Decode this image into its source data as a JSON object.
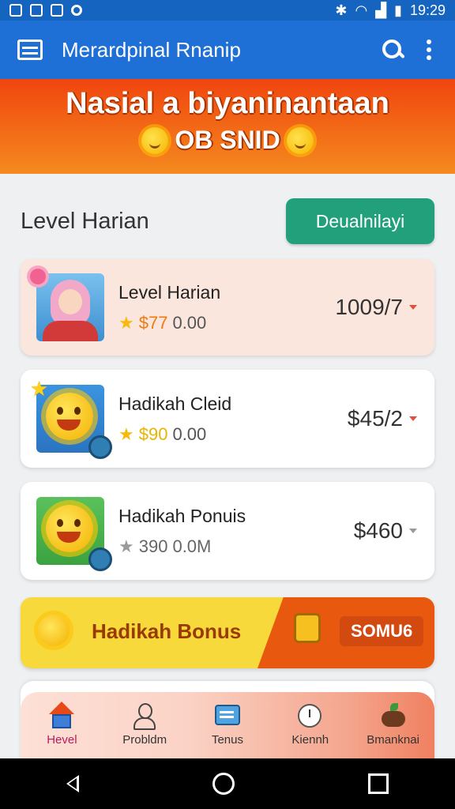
{
  "status_bar": {
    "time": "19:29"
  },
  "app_bar": {
    "title": "Merardpinal Rnanip"
  },
  "banner": {
    "title": "Nasial a biyaninantaan",
    "subtitle": "OB SNID"
  },
  "section": {
    "title": "Level Harian",
    "action_label": "Deualnilayi"
  },
  "cards": [
    {
      "title": "Level Harian",
      "amount_highlight": "$77",
      "amount_rest": "0.00",
      "value": "1009/7"
    },
    {
      "title": "Hadikah Cleid",
      "amount_highlight": "$90",
      "amount_rest": "0.00",
      "value": "$45/2"
    },
    {
      "title": "Hadikah Ponuis",
      "amount_highlight": "390",
      "amount_rest": "0.0M",
      "value": "$460"
    }
  ],
  "bonus": {
    "title": "Hadikah Bonus",
    "tag": "SOMU6"
  },
  "bottom_nav": [
    {
      "label": "Hevel",
      "icon": "home-icon"
    },
    {
      "label": "Probldm",
      "icon": "person-icon"
    },
    {
      "label": "Tenus",
      "icon": "screen-icon"
    },
    {
      "label": "Kiennh",
      "icon": "clock-icon"
    },
    {
      "label": "Bmanknai",
      "icon": "bag-icon"
    }
  ],
  "colors": {
    "appbar": "#1e6fd6",
    "banner": "#f0450f",
    "action": "#22a07c",
    "bonus": "#f7d93b",
    "accent_orange": "#e8580e"
  }
}
